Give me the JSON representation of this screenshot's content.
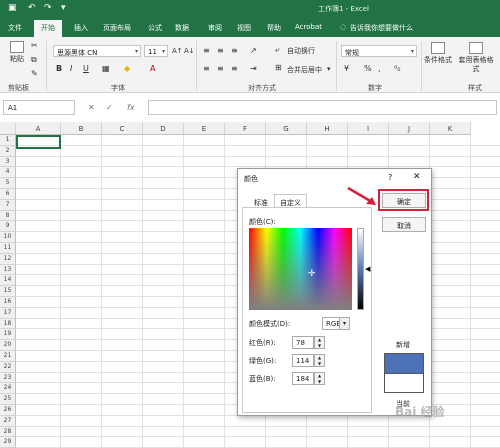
{
  "window": {
    "title": "工作簿1 - Excel",
    "icons": [
      "save-icon",
      "undo-icon",
      "redo-icon",
      "customize-icon"
    ]
  },
  "ribbon_tabs": [
    "文件",
    "开始",
    "插入",
    "页面布局",
    "公式",
    "数据",
    "审阅",
    "视图",
    "帮助",
    "Acrobat"
  ],
  "active_tab": "开始",
  "tell_me": "告诉我你想要做什么",
  "ribbon": {
    "clipboard": {
      "paste": "粘贴",
      "label": "剪贴板"
    },
    "font": {
      "name": "思源黑体 CN",
      "size": "11",
      "grow": "A↑",
      "shrink": "A↓",
      "bold": "B",
      "italic": "I",
      "underline": "U",
      "label": "字体"
    },
    "alignment": {
      "wrap": "自动换行",
      "merge": "合并后居中",
      "label": "对齐方式"
    },
    "number": {
      "format": "常规",
      "currency": "¥",
      "percent": "%",
      "comma": ",",
      "label": "数字"
    },
    "styles": {
      "conditional": "条件格式",
      "table": "套用表格格式",
      "label": "样式"
    }
  },
  "formula_bar": {
    "name_box": "A1",
    "cancel": "✕",
    "enter": "✓",
    "fx": "fx",
    "value": ""
  },
  "grid": {
    "columns": [
      "A",
      "B",
      "C",
      "D",
      "E",
      "F",
      "G",
      "H",
      "I",
      "J",
      "K"
    ],
    "rows": [
      "1",
      "2",
      "3",
      "4",
      "5",
      "6",
      "7",
      "8",
      "9",
      "10",
      "11",
      "12",
      "13",
      "14",
      "15",
      "16",
      "17",
      "18",
      "19",
      "20",
      "21",
      "22",
      "23",
      "24",
      "25",
      "26",
      "27",
      "28",
      "29"
    ]
  },
  "dialog": {
    "title": "颜色",
    "help": "?",
    "close": "✕",
    "tabs": [
      "标准",
      "自定义"
    ],
    "active_tab": "自定义",
    "colors_label": "颜色(C):",
    "model_label": "颜色模式(D):",
    "model_value": "RGB",
    "red_label": "红色(R):",
    "red_value": "78",
    "green_label": "绿色(G):",
    "green_value": "114",
    "blue_label": "蓝色(B):",
    "blue_value": "184",
    "ok": "确定",
    "cancel": "取消",
    "new_label": "新增",
    "current_label": "当前",
    "new_color": "#4E72B8",
    "current_color": "#FFFFFF"
  },
  "watermark": "Bai 经验",
  "colors": {
    "excel_green": "#217346",
    "highlight_red": "#D81F3E"
  }
}
